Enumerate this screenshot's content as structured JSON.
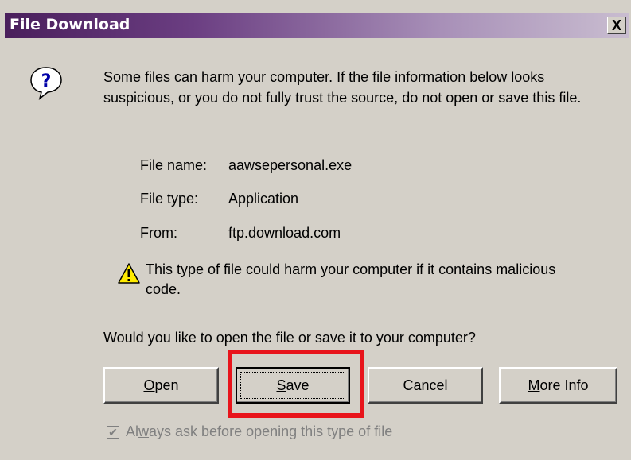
{
  "window": {
    "title": "File Download",
    "close_glyph": "X"
  },
  "message": "Some files can harm your computer. If the file information below looks suspicious, or you do not fully trust the source, do not open or save this file.",
  "file_info": {
    "name_label": "File name:",
    "name_value": "aawsepersonal.exe",
    "type_label": "File type:",
    "type_value": "Application",
    "from_label": "From:",
    "from_value": "ftp.download.com"
  },
  "warning": "This type of file could harm your computer if it contains malicious code.",
  "prompt": "Would you like to open the file or save it to your computer?",
  "buttons": {
    "open": {
      "first": "O",
      "rest": "pen"
    },
    "save": {
      "first": "S",
      "rest": "ave"
    },
    "cancel": "Cancel",
    "more_info": {
      "first": "M",
      "rest": "ore Info"
    }
  },
  "checkbox": {
    "pre": "Al",
    "underlined": "w",
    "post": "ays ask before opening this type of file",
    "checked": true
  },
  "colors": {
    "highlight": "#e8141b",
    "dialog_bg": "#d4d0c8"
  },
  "icons": {
    "question": "question-icon",
    "warning": "warning-icon",
    "close": "close-icon"
  }
}
